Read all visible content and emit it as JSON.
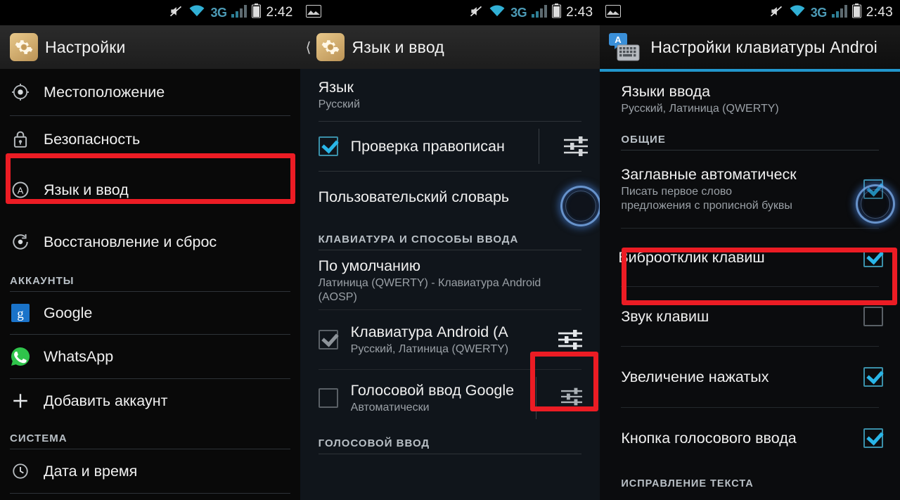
{
  "panels": [
    {
      "name": "settings",
      "statusbar": {
        "mute_icon": "mute-icon",
        "wifi_icon": "wifi-icon",
        "network": "3G",
        "signal_icon": "signal-icon",
        "battery_icon": "battery-icon",
        "time": "2:42",
        "screenshot_icon": ""
      },
      "appbar": {
        "icon": "settings-gear-icon",
        "title": "Настройки",
        "has_back": false
      },
      "items": [
        {
          "label": "Местоположение",
          "icon": "location-icon"
        },
        {
          "label": "Безопасность",
          "icon": "lock-icon"
        },
        {
          "label": "Язык и ввод",
          "icon": "language-input-icon",
          "highlighted": true
        },
        {
          "label": "Восстановление и сброс",
          "icon": "restore-reset-icon"
        },
        {
          "header": "АККАУНТЫ"
        },
        {
          "label": "Google",
          "icon": "google-icon"
        },
        {
          "label": "WhatsApp",
          "icon": "whatsapp-icon"
        },
        {
          "label": "Добавить аккаунт",
          "icon": "plus-icon"
        },
        {
          "header": "СИСТЕМА"
        },
        {
          "label": "Дата и время",
          "icon": "clock-icon"
        }
      ]
    },
    {
      "name": "language-and-input",
      "statusbar": {
        "mute_icon": "mute-icon",
        "wifi_icon": "wifi-icon",
        "network": "3G",
        "signal_icon": "signal-icon",
        "battery_icon": "battery-icon",
        "time": "2:43",
        "screenshot_icon": "screenshot-icon"
      },
      "appbar": {
        "icon": "settings-gear-icon",
        "title": "Язык и ввод",
        "has_back": true
      },
      "items": [
        {
          "label": "Язык",
          "sub": "Русский"
        },
        {
          "label": "Проверка правописан",
          "checkbox": "checked",
          "settings_icon": "sliders-icon"
        },
        {
          "label": "Пользовательский словарь"
        },
        {
          "header": "КЛАВИАТУРА И СПОСОБЫ ВВОДА"
        },
        {
          "label": "По умолчанию",
          "sub": "Латиница (QWERTY) - Клавиатура Android (AOSP)"
        },
        {
          "label": "Клавиатура Android (A",
          "sub": "Русский, Латиница (QWERTY)",
          "checkbox": "checked-disabled",
          "settings_icon": "sliders-icon",
          "highlight_settings": true
        },
        {
          "label": "Голосовой ввод Google",
          "sub": "Автоматически",
          "checkbox": "unchecked",
          "settings_icon": "sliders-icon"
        },
        {
          "header": "ГОЛОСОВОЙ ВВОД"
        }
      ]
    },
    {
      "name": "android-keyboard-settings",
      "statusbar": {
        "mute_icon": "mute-icon",
        "wifi_icon": "wifi-icon",
        "network": "3G",
        "signal_icon": "signal-icon",
        "battery_icon": "battery-icon",
        "time": "2:43",
        "screenshot_icon": "screenshot-icon"
      },
      "appbar": {
        "icon": "android-keyboard-icon",
        "title": "Настройки клавиатуры Androi",
        "has_back": false,
        "underline": true
      },
      "items": [
        {
          "label": "Языки ввода",
          "sub": "Русский, Латиница (QWERTY)"
        },
        {
          "header": "ОБЩИЕ"
        },
        {
          "label": "Заглавные автоматическ",
          "sub": "Писать первое слово предложения с прописной буквы",
          "checkbox": "checked"
        },
        {
          "label": "Виброотклик клавиш",
          "checkbox": "checked",
          "highlighted": true
        },
        {
          "label": "Звук клавиш",
          "checkbox": "unchecked"
        },
        {
          "label": "Увеличение нажатых",
          "checkbox": "checked"
        },
        {
          "label": "Кнопка голосового ввода",
          "checkbox": "checked"
        },
        {
          "header": "ИСПРАВЛЕНИЕ ТЕКСТА"
        }
      ]
    }
  ],
  "colors": {
    "highlight_red": "#ec1c24",
    "accent_blue": "#29b6e8",
    "appbar_underline": "#2196cc",
    "network_text": "#4c9ab5"
  }
}
